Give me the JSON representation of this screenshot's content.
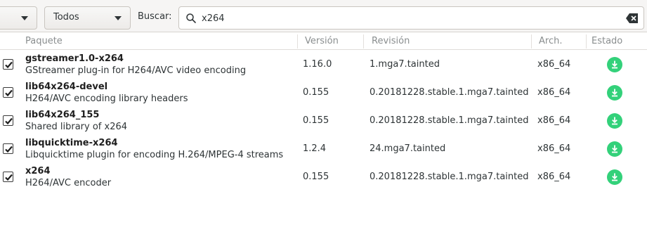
{
  "toolbar": {
    "filter1_value": "",
    "filter2_value": "Todos",
    "search_label": "Buscar:",
    "search_value": "x264",
    "search_icon": "search-icon",
    "clear_icon": "clear-text-icon"
  },
  "table": {
    "columns": [
      "Paquete",
      "Versión",
      "Revisión",
      "Arch.",
      "Estado"
    ],
    "rows": [
      {
        "name": "gstreamer1.0-x264",
        "desc": "GStreamer plug-in for H264/AVC video encoding",
        "version": "1.16.0",
        "revision": "1.mga7.tainted",
        "arch": "x86_64",
        "checked": true,
        "status": "download-icon"
      },
      {
        "name": "lib64x264-devel",
        "desc": "H264/AVC encoding library headers",
        "version": "0.155",
        "revision": "0.20181228.stable.1.mga7.tainted",
        "arch": "x86_64",
        "checked": true,
        "status": "download-icon"
      },
      {
        "name": "lib64x264_155",
        "desc": "Shared library of x264",
        "version": "0.155",
        "revision": "0.20181228.stable.1.mga7.tainted",
        "arch": "x86_64",
        "checked": true,
        "status": "download-icon"
      },
      {
        "name": "libquicktime-x264",
        "desc": "Libquicktime plugin for encoding H.264/MPEG-4 streams",
        "version": "1.2.4",
        "revision": "24.mga7.tainted",
        "arch": "x86_64",
        "checked": true,
        "status": "download-icon"
      },
      {
        "name": "x264",
        "desc": "H264/AVC encoder",
        "version": "0.155",
        "revision": "0.20181228.stable.1.mga7.tainted",
        "arch": "x86_64",
        "checked": true,
        "status": "download-icon"
      }
    ]
  },
  "colors": {
    "status_green": "#33d17a",
    "header_text": "#8a8e8f"
  }
}
